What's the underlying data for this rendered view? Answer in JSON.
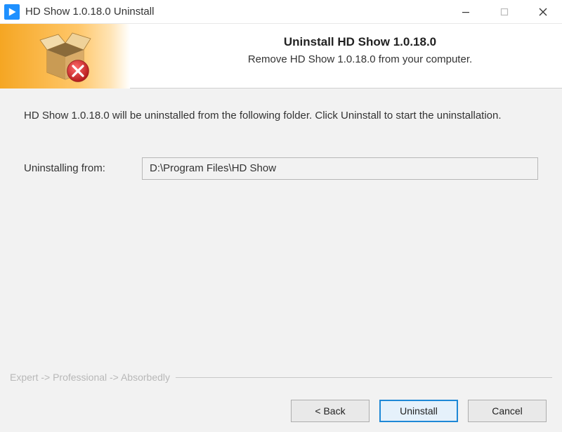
{
  "titlebar": {
    "title": "HD Show 1.0.18.0 Uninstall"
  },
  "header": {
    "title": "Uninstall HD Show 1.0.18.0",
    "subtitle": "Remove HD Show 1.0.18.0 from your computer."
  },
  "content": {
    "instruction": "HD Show 1.0.18.0 will be uninstalled from the following folder. Click Uninstall to start the uninstallation.",
    "path_label": "Uninstalling from:",
    "path_value": "D:\\Program Files\\HD Show"
  },
  "breadcrumb": "Expert -> Professional -> Absorbedly",
  "footer": {
    "back_label": "< Back",
    "uninstall_label": "Uninstall",
    "cancel_label": "Cancel"
  }
}
